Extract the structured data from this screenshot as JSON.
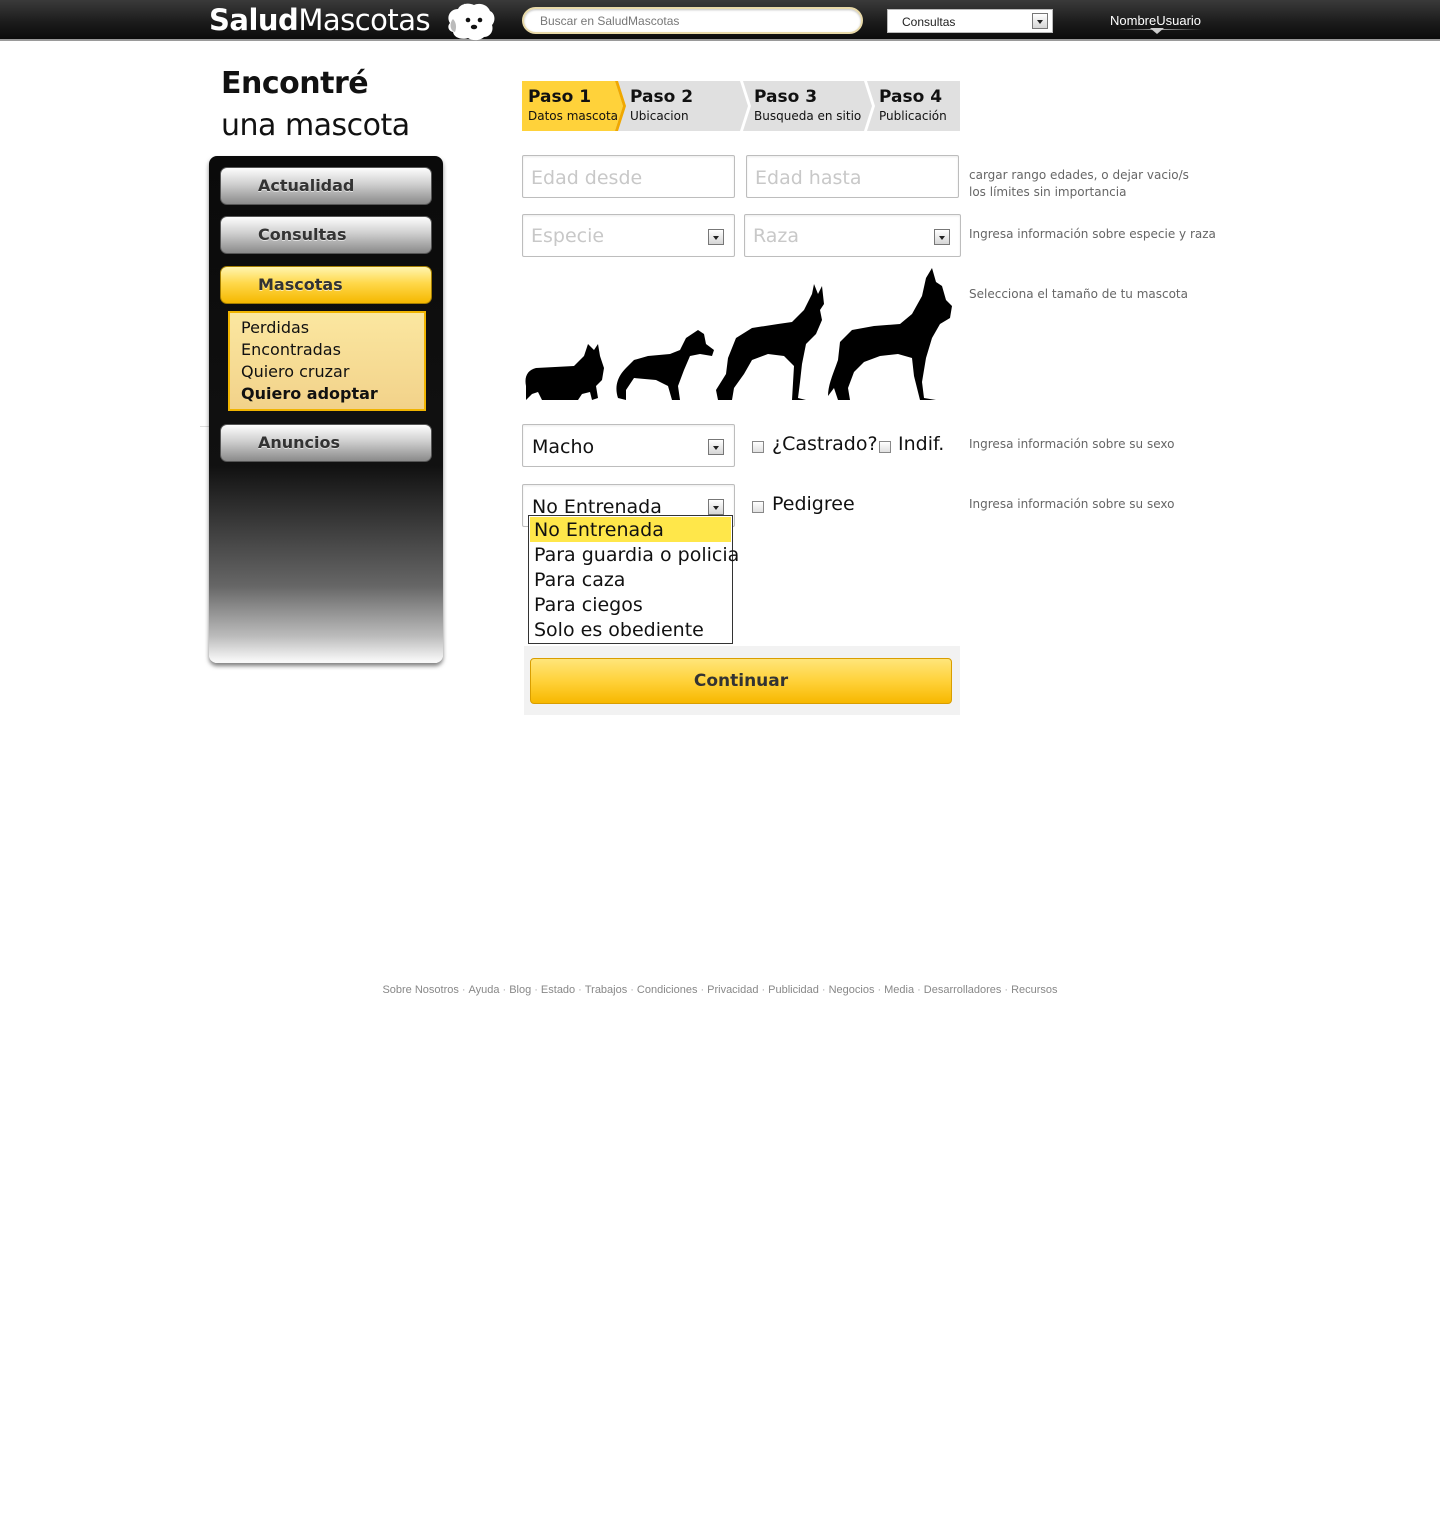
{
  "header": {
    "logo_bold": "Salud",
    "logo_regular": "Mascotas",
    "search_placeholder": "Buscar en SaludMascotas",
    "section_select": "Consultas",
    "username": "NombreUsuario"
  },
  "page": {
    "title_line1": "Encontré",
    "title_line2": "una mascota"
  },
  "sidebar": {
    "items": [
      {
        "label": "Actualidad"
      },
      {
        "label": "Consultas"
      },
      {
        "label": "Mascotas"
      },
      {
        "label": "Anuncios"
      }
    ],
    "subitems": [
      {
        "label": "Perdidas"
      },
      {
        "label": "Encontradas"
      },
      {
        "label": "Quiero cruzar"
      },
      {
        "label": "Quiero adoptar"
      }
    ]
  },
  "steps": [
    {
      "title": "Paso 1",
      "subtitle": "Datos mascota"
    },
    {
      "title": "Paso 2",
      "subtitle": "Ubicacion"
    },
    {
      "title": "Paso 3",
      "subtitle": "Busqueda en sitio"
    },
    {
      "title": "Paso 4",
      "subtitle": "Publicación"
    }
  ],
  "form": {
    "age_from_placeholder": "Edad desde",
    "age_to_placeholder": "Edad hasta",
    "age_hint_line1": "cargar rango edades, o dejar vacio/s",
    "age_hint_line2": "los límites sin importancia",
    "species_placeholder": "Especie",
    "breed_placeholder": "Raza",
    "species_hint": "Ingresa información sobre especie y raza",
    "size_hint": "Selecciona el tamaño de tu mascota",
    "sex_value": "Macho",
    "castrated_label": "¿Castrado?",
    "indif_label": "Indif.",
    "sex_hint": "Ingresa información sobre su sexo",
    "training_value": "No Entrenada",
    "pedigree_label": "Pedigree",
    "training_hint": "Ingresa información sobre su sexo",
    "training_options": [
      "No Entrenada",
      "Para guardia o policia",
      "Para caza",
      "Para ciegos",
      "Solo es obediente"
    ],
    "continue_label": "Continuar"
  },
  "footer": {
    "links": [
      "Sobre Nosotros",
      "Ayuda",
      "Blog",
      "Estado",
      "Trabajos",
      "Condiciones",
      "Privacidad",
      "Publicidad",
      "Negocios",
      "Media",
      "Desarrolladores",
      "Recursos"
    ],
    "separator": "·"
  },
  "colors": {
    "accent_yellow": "#ffd23a",
    "topbar": "#1a1a1a",
    "highlight": "#ffe74a"
  }
}
